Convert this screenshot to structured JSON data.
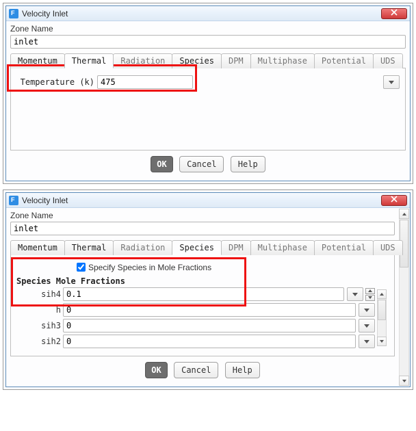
{
  "dialog1": {
    "title": "Velocity Inlet",
    "zone_label": "Zone Name",
    "zone_value": "inlet",
    "tabs": {
      "momentum": "Momentum",
      "thermal": "Thermal",
      "radiation": "Radiation",
      "species": "Species",
      "dpm": "DPM",
      "multiphase": "Multiphase",
      "potential": "Potential",
      "uds": "UDS"
    },
    "temp_label": "Temperature (k)",
    "temp_value": "475",
    "buttons": {
      "ok": "OK",
      "cancel": "Cancel",
      "help": "Help"
    }
  },
  "dialog2": {
    "title": "Velocity Inlet",
    "zone_label": "Zone Name",
    "zone_value": "inlet",
    "tabs": {
      "momentum": "Momentum",
      "thermal": "Thermal",
      "radiation": "Radiation",
      "species": "Species",
      "dpm": "DPM",
      "multiphase": "Multiphase",
      "potential": "Potential",
      "uds": "UDS"
    },
    "check_label": "Specify Species in Mole Fractions",
    "mf_title": "Species Mole Fractions",
    "species": [
      {
        "name": "sih4",
        "value": "0.1"
      },
      {
        "name": "h",
        "value": "0"
      },
      {
        "name": "sih3",
        "value": "0"
      },
      {
        "name": "sih2",
        "value": "0"
      }
    ],
    "buttons": {
      "ok": "OK",
      "cancel": "Cancel",
      "help": "Help"
    }
  }
}
